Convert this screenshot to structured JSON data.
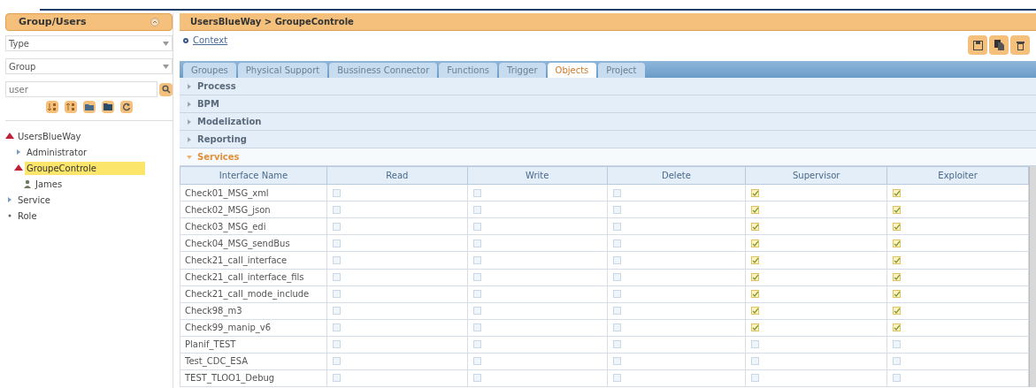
{
  "sidebar": {
    "title": "Group/Users",
    "type_select": {
      "value": "Type"
    },
    "group_select": {
      "value": "Group"
    },
    "search": {
      "value": "user"
    },
    "tree": [
      {
        "label": "UsersBlueWay",
        "kind": "folder",
        "expanded": true,
        "selected": false,
        "children": [
          {
            "label": "Administrator",
            "kind": "folder",
            "expanded": false,
            "selected": false
          },
          {
            "label": "GroupeControle",
            "kind": "folder",
            "expanded": true,
            "selected": true,
            "children": [
              {
                "label": "James",
                "kind": "user",
                "selected": false
              }
            ]
          }
        ]
      },
      {
        "label": "Service",
        "kind": "folder",
        "expanded": false,
        "selected": false
      },
      {
        "label": "Role",
        "kind": "leaf",
        "selected": false
      }
    ]
  },
  "main": {
    "breadcrumb": "UsersBlueWay > GroupeControle",
    "context_link": "Context",
    "tabs": [
      {
        "label": "Groupes",
        "selected": false
      },
      {
        "label": "Physical Support",
        "selected": false
      },
      {
        "label": "Bussiness Connector",
        "selected": false
      },
      {
        "label": "Functions",
        "selected": false
      },
      {
        "label": "Trigger",
        "selected": false
      },
      {
        "label": "Objects",
        "selected": true
      },
      {
        "label": "Project",
        "selected": false
      }
    ],
    "sections": [
      {
        "label": "Process",
        "expanded": false
      },
      {
        "label": "BPM",
        "expanded": false
      },
      {
        "label": "Modelization",
        "expanded": false
      },
      {
        "label": "Reporting",
        "expanded": false
      },
      {
        "label": "Services",
        "expanded": true
      }
    ],
    "table": {
      "columns": [
        "Interface Name",
        "Read",
        "Write",
        "Delete",
        "Supervisor",
        "Exploiter"
      ],
      "rows": [
        {
          "name": "Check01_MSG_xml",
          "checks": [
            false,
            false,
            false,
            true,
            true
          ]
        },
        {
          "name": "Check02_MSG_json",
          "checks": [
            false,
            false,
            false,
            true,
            true
          ]
        },
        {
          "name": "Check03_MSG_edi",
          "checks": [
            false,
            false,
            false,
            true,
            true
          ]
        },
        {
          "name": "Check04_MSG_sendBus",
          "checks": [
            false,
            false,
            false,
            true,
            true
          ]
        },
        {
          "name": "Check21_call_interface",
          "checks": [
            false,
            false,
            false,
            true,
            true
          ]
        },
        {
          "name": "Check21_call_interface_fils",
          "checks": [
            false,
            false,
            false,
            true,
            true
          ]
        },
        {
          "name": "Check21_call_mode_include",
          "checks": [
            false,
            false,
            false,
            true,
            true
          ]
        },
        {
          "name": "Check98_m3",
          "checks": [
            false,
            false,
            false,
            true,
            true
          ]
        },
        {
          "name": "Check99_manip_v6",
          "checks": [
            false,
            false,
            false,
            true,
            true
          ]
        },
        {
          "name": "Planif_TEST",
          "checks": [
            false,
            false,
            false,
            false,
            false
          ]
        },
        {
          "name": "Test_CDC_ESA",
          "checks": [
            false,
            false,
            false,
            false,
            false
          ]
        },
        {
          "name": "TEST_TLOO1_Debug",
          "checks": [
            false,
            false,
            false,
            false,
            false
          ]
        }
      ]
    }
  }
}
